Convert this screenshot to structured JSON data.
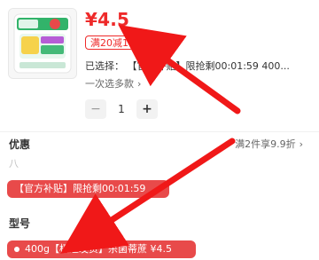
{
  "product": {
    "price": "¥4.5",
    "coupon": "满20减1",
    "selected_label": "已选择：",
    "selected_value": "【官方补贴】限抢剩00:01:59 400...",
    "multi_select_label": "一次选多款",
    "quantity": "1",
    "minus_symbol": "−",
    "plus_symbol": "+",
    "chevron": "›"
  },
  "offers": {
    "title": "优惠",
    "right_text": "满2件享9.9折",
    "chevron": "›",
    "faint_text": "八"
  },
  "promo": {
    "chip_text": "【官方补贴】限抢剩00:01:59"
  },
  "model": {
    "title": "型号",
    "selected_chip_text": "400g【极速发货】杀菌蒂蔗 ¥4.5"
  },
  "colors": {
    "accent_red": "#ee2a2a",
    "chip_red": "#e84a4a",
    "text_dark": "#333333",
    "text_muted": "#666666",
    "arrow_red": "#f01818"
  },
  "icons": {
    "product_thumbnail": "product-thumbnail-icon",
    "arrow": "red-arrow-icon"
  }
}
